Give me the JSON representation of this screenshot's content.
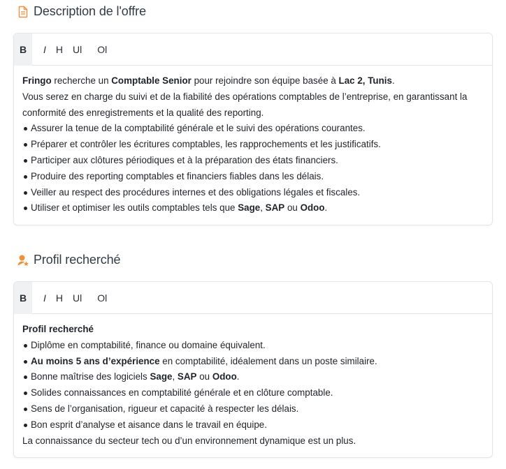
{
  "offer": {
    "title": "Description de l'offre",
    "toolbar": {
      "bold": "B",
      "italic": "I",
      "heading": "H",
      "ul": "Ul",
      "ol": "Ol"
    },
    "intro_company": "Fringo",
    "intro_text_1": " recherche un ",
    "intro_role": "Comptable Senior",
    "intro_text_2": " pour rejoindre son équipe basée à ",
    "intro_location": "Lac 2, Tunis",
    "intro_text_3": ".",
    "paragraph": "Vous serez en charge du suivi et de la fiabilité des opérations comptables de l’entreprise, en garantissant la conformité des enregistrements et la qualité des reporting.",
    "bullets": [
      "Assurer la tenue de la comptabilité générale et le suivi des opérations courantes.",
      "Préparer et contrôler les écritures comptables, les rapprochements et les justificatifs.",
      "Participer aux clôtures périodiques et à la préparation des états financiers.",
      "Produire des reporting comptables et financiers fiables dans les délais.",
      "Veiller au respect des procédures internes et des obligations légales et fiscales."
    ],
    "tools_prefix": "Utiliser et optimiser les outils comptables tels que ",
    "tools_1": "Sage",
    "tools_sep": ", ",
    "tools_2": "SAP",
    "tools_or": " ou ",
    "tools_3": "Odoo",
    "tools_end": "."
  },
  "profile": {
    "title": "Profil recherché",
    "toolbar": {
      "bold": "B",
      "italic": "I",
      "heading": "H",
      "ul": "Ul",
      "ol": "Ol"
    },
    "heading": "Profil recherché",
    "bullet_1": "Diplôme en comptabilité, finance ou domaine équivalent.",
    "bullet_2_bold": "Au moins 5 ans d’expérience",
    "bullet_2_rest": " en comptabilité, idéalement dans un poste similaire.",
    "bullet_3_prefix": "Bonne maîtrise des logiciels ",
    "bullet_3_sage": "Sage",
    "bullet_3_sep": ", ",
    "bullet_3_sap": "SAP",
    "bullet_3_or": " ou ",
    "bullet_3_odoo": "Odoo",
    "bullet_3_end": ".",
    "bullet_4": "Solides connaissances en comptabilité générale et en clôture comptable.",
    "bullet_5": "Sens de l’organisation, rigueur et capacité à respecter les délais.",
    "bullet_6": "Bon esprit d’analyse et aisance dans le travail en équipe.",
    "closing": "La connaissance du secteur tech ou d’un environnement dynamique est un plus."
  },
  "colors": {
    "icon_accent": "#f0913a",
    "border": "#e3e5e8",
    "toolbar_active": "#f0f1f3"
  },
  "icons": {
    "offer": "document-icon",
    "profile": "user-award-icon"
  }
}
